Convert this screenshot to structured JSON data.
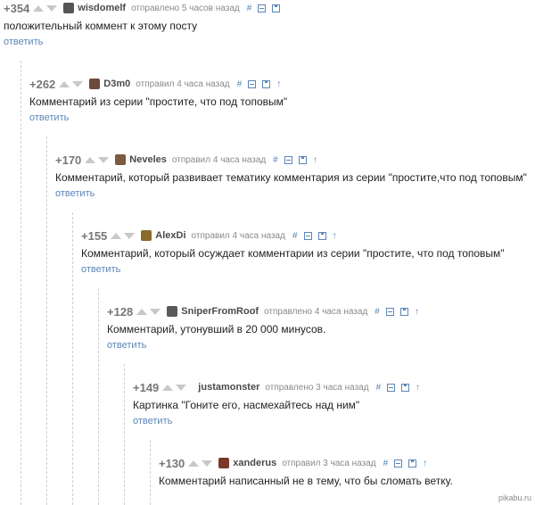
{
  "comments": [
    {
      "rating": "+354",
      "user": "wisdomelf",
      "time": "отправлено 5 часов назад",
      "text": "положительный коммент к этому посту",
      "reply": "ответить",
      "avatar_color": "#555555",
      "has_up_icon": false
    },
    {
      "rating": "+262",
      "user": "D3m0",
      "time": "отправил 4 часа назад",
      "text": "Комментарий из серии \"простите, что под топовым\"",
      "reply": "ответить",
      "avatar_color": "#6b4a3a",
      "has_up_icon": true
    },
    {
      "rating": "+170",
      "user": "Neveles",
      "time": "отправил 4 часа назад",
      "text": "Комментарий, который развивает тематику комментария из серии \"простите,что под топовым\"",
      "reply": "ответить",
      "avatar_color": "#7a5a40",
      "has_up_icon": true
    },
    {
      "rating": "+155",
      "user": "AlexDi",
      "time": "отправил 4 часа назад",
      "text": "Комментарий, который осуждает комментарии из серии \"простите, что под топовым\"",
      "reply": "ответить",
      "avatar_color": "#8a6a2a",
      "has_up_icon": true
    },
    {
      "rating": "+128",
      "user": "SniperFromRoof",
      "time": "отправлено 4 часа назад",
      "text": "Комментарий, утонувший в 20 000 минусов.",
      "reply": "ответить",
      "avatar_color": "#5a5a5a",
      "has_up_icon": true
    },
    {
      "rating": "+149",
      "user": "justamonster",
      "time": "отправлено 3 часа назад",
      "text": "Картинка \"Гоните его, насмехайтесь над ним\"",
      "reply": "ответить",
      "avatar_color": "",
      "has_up_icon": true
    },
    {
      "rating": "+130",
      "user": "xanderus",
      "time": "отправил 3 часа назад",
      "text": "Комментарий написанный не в тему, что бы сломать ветку.",
      "reply": "",
      "avatar_color": "#7a3a2a",
      "has_up_icon": true
    }
  ],
  "icons": {
    "hash": "#",
    "up": "↑"
  },
  "watermark": "pikabu.ru"
}
